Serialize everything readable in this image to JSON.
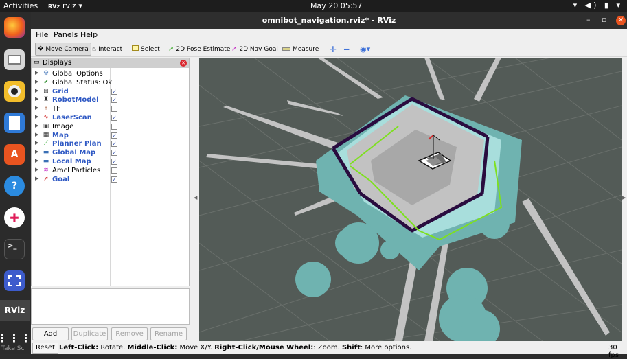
{
  "topbar": {
    "activities": "Activities",
    "app_tag": "RVz",
    "app_name": "rviz ▾",
    "clock": "May 20  05:57",
    "tray": "▾ ◀) ▮ ▾"
  },
  "dock": {
    "apps": [
      "firefox-icon",
      "files-icon",
      "rhythmbox-icon",
      "writer-icon",
      "software-icon",
      "help-icon",
      "slack-icon",
      "terminal-icon",
      "screenshot-icon",
      "rviz-icon",
      "app-grid-icon"
    ],
    "rviz_label": "RViz",
    "take_screenshot_label": "Take Sc"
  },
  "window": {
    "title": "omnibot_navigation.rviz* - RViz",
    "minimize": "–",
    "maximize": "▫",
    "close": "✕"
  },
  "menubar": {
    "file": "File",
    "panels": "Panels",
    "help": "Help"
  },
  "toolbar": {
    "move_camera": "Move Camera",
    "interact": "Interact",
    "select": "Select",
    "pose_estimate": "2D Pose Estimate",
    "nav_goal": "2D Nav Goal",
    "measure": "Measure"
  },
  "displays": {
    "title": "Displays",
    "items": [
      {
        "label": "Global Options",
        "icon": "gear-icon",
        "checkbox": null,
        "link": false
      },
      {
        "label": "Global Status: Ok",
        "icon": "checkmark-icon",
        "checkbox": null,
        "link": false
      },
      {
        "label": "Grid",
        "icon": "grid-icon",
        "checkbox": true,
        "link": true
      },
      {
        "label": "RobotModel",
        "icon": "robot-icon",
        "checkbox": true,
        "link": true
      },
      {
        "label": "TF",
        "icon": "tf-icon",
        "checkbox": false,
        "link": false
      },
      {
        "label": "LaserScan",
        "icon": "laser-icon",
        "checkbox": true,
        "link": true
      },
      {
        "label": "Image",
        "icon": "image-icon",
        "checkbox": false,
        "link": false
      },
      {
        "label": "Map",
        "icon": "map-icon",
        "checkbox": true,
        "link": true
      },
      {
        "label": "Planner Plan",
        "icon": "path-icon",
        "checkbox": true,
        "link": true
      },
      {
        "label": "Global Map",
        "icon": "folder-icon",
        "checkbox": true,
        "link": true
      },
      {
        "label": "Local Map",
        "icon": "folder-icon",
        "checkbox": true,
        "link": true
      },
      {
        "label": "Amcl Particles",
        "icon": "particles-icon",
        "checkbox": false,
        "link": false
      },
      {
        "label": "Goal",
        "icon": "arrow-icon",
        "checkbox": true,
        "link": true
      }
    ],
    "buttons": {
      "add": "Add",
      "duplicate": "Duplicate",
      "remove": "Remove",
      "rename": "Rename"
    }
  },
  "statusbar": {
    "reset": "Reset",
    "hint_parts": [
      {
        "b": "Left-Click:"
      },
      {
        "t": " Rotate. "
      },
      {
        "b": "Middle-Click:"
      },
      {
        "t": " Move X/Y. "
      },
      {
        "b": "Right-Click/Mouse Wheel:"
      },
      {
        "t": ": Zoom. "
      },
      {
        "b": "Shift"
      },
      {
        "t": ": More options."
      }
    ],
    "fps": "30 fps"
  },
  "colors": {
    "viewport_bg": "#535b57",
    "costmap": "#6fb3b0",
    "costmap_light": "#a8dedc",
    "occupied": "#2a0c3f",
    "free": "#bfbfbf",
    "plan": "#7ee01f",
    "accent": "#e95420",
    "link_blue": "#2f59c4"
  }
}
